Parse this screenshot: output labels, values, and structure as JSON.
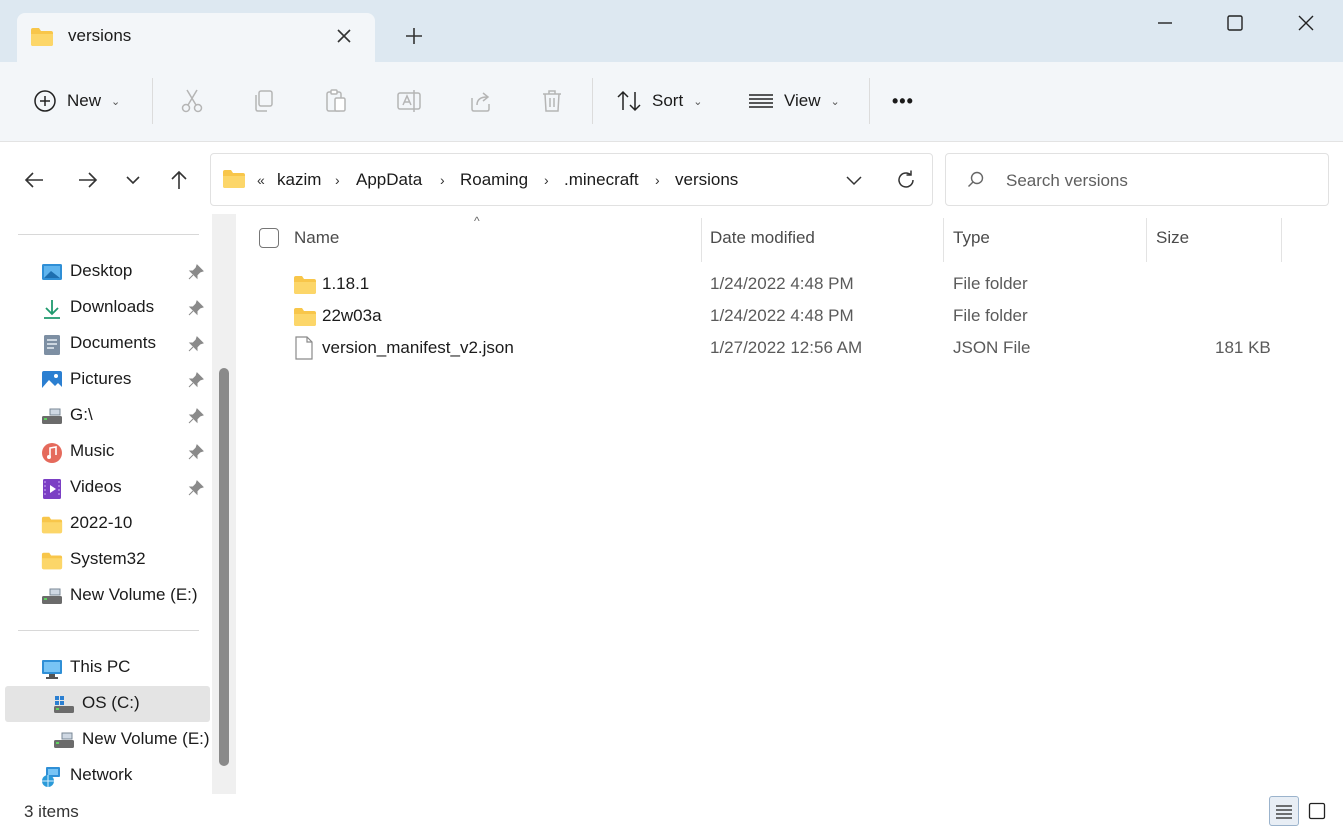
{
  "window": {
    "tab_title": "versions",
    "new_tab_label": "+"
  },
  "toolbar": {
    "new_label": "New",
    "sort_label": "Sort",
    "view_label": "View",
    "more_label": "•••"
  },
  "address": {
    "overflow": "«",
    "crumbs": [
      "kazim",
      "AppData",
      "Roaming",
      ".minecraft",
      "versions"
    ]
  },
  "search": {
    "placeholder": "Search versions"
  },
  "sidebar": {
    "quick_access": [
      {
        "label": "Desktop",
        "icon": "desktop-icon",
        "pinned": true
      },
      {
        "label": "Downloads",
        "icon": "download-icon",
        "pinned": true
      },
      {
        "label": "Documents",
        "icon": "documents-icon",
        "pinned": true
      },
      {
        "label": "Pictures",
        "icon": "pictures-icon",
        "pinned": true
      },
      {
        "label": "G:\\",
        "icon": "drive-icon",
        "pinned": true
      },
      {
        "label": "Music",
        "icon": "music-icon",
        "pinned": true
      },
      {
        "label": "Videos",
        "icon": "videos-icon",
        "pinned": true
      },
      {
        "label": "2022-10",
        "icon": "folder-icon",
        "pinned": false
      },
      {
        "label": "System32",
        "icon": "folder-icon",
        "pinned": false
      },
      {
        "label": "New Volume (E:)",
        "icon": "drive-icon",
        "pinned": false
      }
    ],
    "this_pc": "This PC",
    "os_drive": "OS (C:)",
    "new_volume": "New Volume (E:)",
    "network": "Network"
  },
  "columns": {
    "name": "Name",
    "date": "Date modified",
    "type": "Type",
    "size": "Size"
  },
  "files": [
    {
      "name": "1.18.1",
      "date": "1/24/2022 4:48 PM",
      "type": "File folder",
      "size": "",
      "icon": "folder-icon"
    },
    {
      "name": "22w03a",
      "date": "1/24/2022 4:48 PM",
      "type": "File folder",
      "size": "",
      "icon": "folder-icon"
    },
    {
      "name": "version_manifest_v2.json",
      "date": "1/27/2022 12:56 AM",
      "type": "JSON File",
      "size": "181 KB",
      "icon": "file-icon"
    }
  ],
  "status": {
    "item_count": "3 items"
  },
  "colors": {
    "titlebar": "#dde8f1",
    "toolbar": "#f3f6f9",
    "folder": "#f8c64a",
    "accent": "#0067c0"
  }
}
